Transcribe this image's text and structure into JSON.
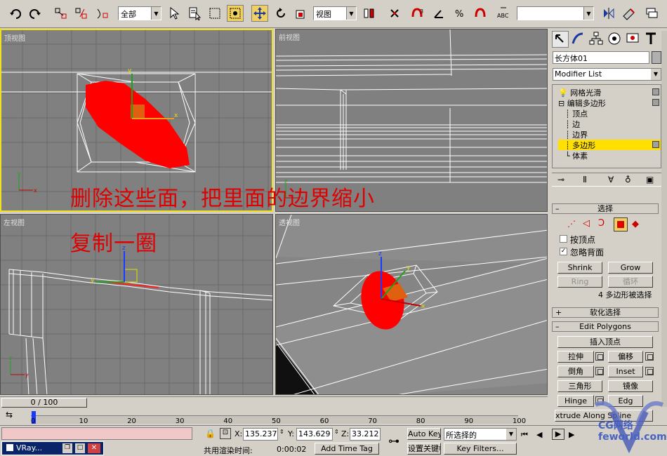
{
  "toolbar": {
    "selection_filter": "全部",
    "ref_coord": "视图",
    "named_selection": ""
  },
  "viewports": {
    "top": {
      "label": "顶视图"
    },
    "front": {
      "label": "前视图"
    },
    "left": {
      "label": "左视图"
    },
    "persp": {
      "label": "透视图"
    }
  },
  "annotations": {
    "line1": "删除这些面，把里面的边界缩小",
    "line2": "复制一圈"
  },
  "command_panel": {
    "object_name": "长方体01",
    "modifier_list": "Modifier List",
    "stack": [
      {
        "label": "网格光滑",
        "prefix": "◙ ▣"
      },
      {
        "label": "编辑多边形",
        "prefix": "⊟"
      },
      {
        "label": "顶点",
        "prefix": "┊"
      },
      {
        "label": "边",
        "prefix": "┊"
      },
      {
        "label": "边界",
        "prefix": "┊"
      },
      {
        "label": "多边形",
        "prefix": "┊"
      },
      {
        "label": "体素",
        "prefix": "└"
      }
    ],
    "selection_rollout": {
      "title": "选择",
      "by_vertex": "按顶点",
      "ignore_backfacing": "忽略背面",
      "shrink": "Shrink",
      "grow": "Grow",
      "ring": "Ring",
      "loop": "循环",
      "status": "4 多边形被选择"
    },
    "soft_selection": "软化选择",
    "edit_polygons": {
      "title": "Edit Polygons",
      "insert_vertex": "插入顶点",
      "extrude": "拉伸",
      "outline": "偏移",
      "bevel": "倒角",
      "inset": "Inset",
      "triangulate": "三角形",
      "mirror": "镜像",
      "hinge": "Hinge",
      "edge": "Edg",
      "extrude_along": "xtrude Along Spline"
    }
  },
  "timeline": {
    "frame_display": "0 / 100",
    "ticks": [
      "0",
      "10",
      "20",
      "30",
      "40",
      "50",
      "60",
      "70",
      "80",
      "90",
      "100"
    ]
  },
  "status": {
    "x": "135.237",
    "y": "143.629",
    "z": "33.212",
    "render_time_label": "共用渲染时间:",
    "render_time": "0:00:02",
    "add_time_tag": "Add Time Tag",
    "auto_key": "Auto Key",
    "set_key": "设置关键帧",
    "key_mode": "所选择的",
    "key_filters": "Key Filters...",
    "taskbar_item": "VRay...",
    "watermark": "CG网络\nfeworld.com"
  },
  "colors": {
    "selected_poly": "#ff0000",
    "active_viewport": "#f0e020",
    "annotation": "#e00000",
    "stack_highlight": "#ffe000"
  }
}
